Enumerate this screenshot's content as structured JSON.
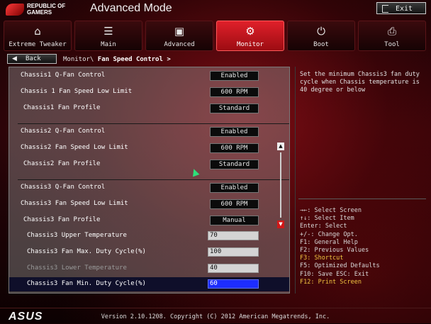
{
  "app": {
    "title": "Advanced Mode",
    "logo_text": "REPUBLIC OF GAMERS",
    "exit_label": "Exit"
  },
  "tabs": [
    {
      "label": "Extreme Tweaker",
      "icon": "tweaker-icon",
      "glyph": "⌂"
    },
    {
      "label": "Main",
      "icon": "list-icon",
      "glyph": "☰"
    },
    {
      "label": "Advanced",
      "icon": "advanced-icon",
      "glyph": "▣"
    },
    {
      "label": "Monitor",
      "icon": "monitor-icon",
      "glyph": "⚙",
      "active": true
    },
    {
      "label": "Boot",
      "icon": "power-icon",
      "glyph": "⏻"
    },
    {
      "label": "Tool",
      "icon": "tool-icon",
      "glyph": "⎙"
    }
  ],
  "nav": {
    "back_label": "Back",
    "breadcrumb_parent": "Monitor\\",
    "breadcrumb_current": "Fan Speed Control >"
  },
  "settings": [
    {
      "label": "Chassis1 Q-Fan Control",
      "value": "Enabled"
    },
    {
      "label": "Chassis 1 Fan Speed Low Limit",
      "value": "600 RPM"
    },
    {
      "label": "Chassis1 Fan Profile",
      "value": "Standard"
    },
    {
      "label": "Chassis2 Q-Fan Control",
      "value": "Enabled"
    },
    {
      "label": "Chassis2 Fan Speed Low Limit",
      "value": "600 RPM"
    },
    {
      "label": "Chassis2 Fan Profile",
      "value": "Standard"
    },
    {
      "label": "Chassis3 Q-Fan Control",
      "value": "Enabled"
    },
    {
      "label": "Chassis3 Fan Speed Low Limit",
      "value": "600 RPM"
    },
    {
      "label": "Chassis3 Fan Profile",
      "value": "Manual"
    },
    {
      "label": "Chassis3 Upper Temperature",
      "value": "70"
    },
    {
      "label": "Chassis3 Fan Max. Duty Cycle(%)",
      "value": "100"
    },
    {
      "label": "Chassis3 Lower Temperature",
      "value": "40"
    },
    {
      "label": "Chassis3 Fan Min. Duty Cycle(%)",
      "value": "60"
    }
  ],
  "help_text": "Set the minimum Chassis3 fan duty cycle when Chassis temperature is 40 degree or below",
  "key_help": [
    "→←: Select Screen",
    "↑↓: Select Item",
    "Enter: Select",
    "+/-: Change Opt.",
    "F1: General Help",
    "F2: Previous Values",
    "F3: Shortcut",
    "F5: Optimized Defaults",
    "F10: Save  ESC: Exit",
    "F12: Print Screen"
  ],
  "footer": {
    "brand": "ASUS",
    "version": "Version 2.10.1208. Copyright (C) 2012 American Megatrends, Inc."
  },
  "colors": {
    "accent": "#d01818",
    "selected": "#1d2dff",
    "highlight_key": "#f2c640"
  }
}
